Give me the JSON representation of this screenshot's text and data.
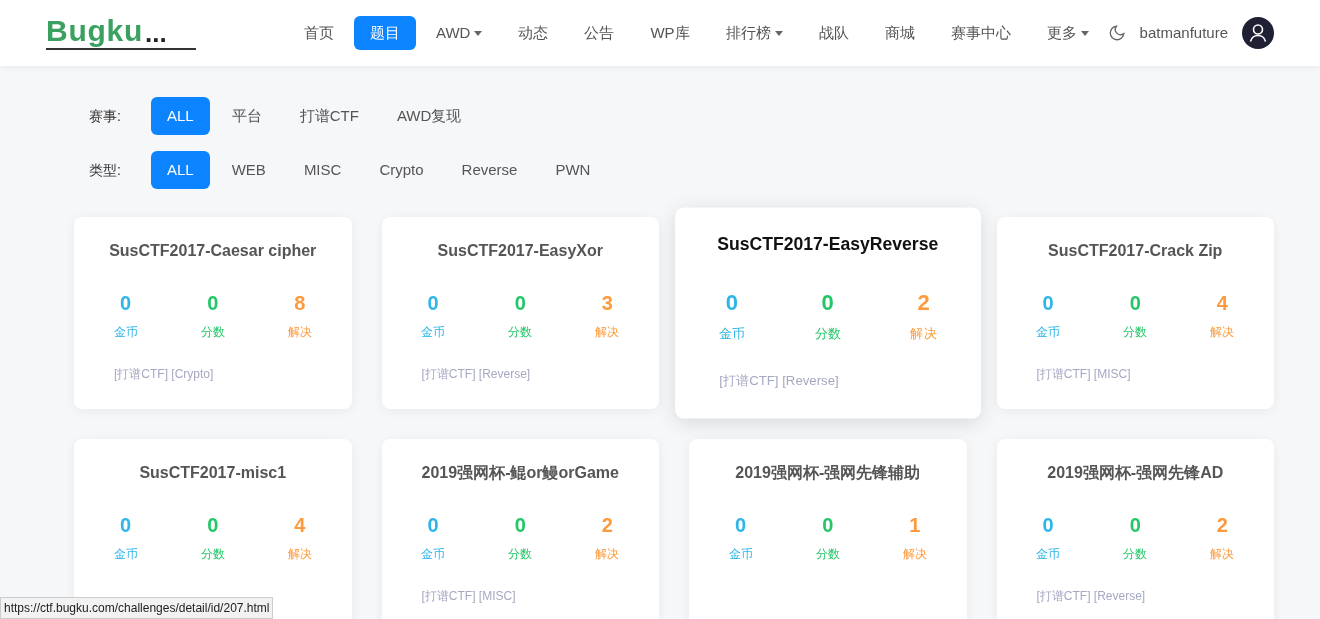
{
  "logo": {
    "text": "Bugku",
    "suffix": "..."
  },
  "nav": [
    {
      "label": "首页",
      "selected": false,
      "dropdown": false
    },
    {
      "label": "题目",
      "selected": true,
      "dropdown": false
    },
    {
      "label": "AWD",
      "selected": false,
      "dropdown": true
    },
    {
      "label": "动态",
      "selected": false,
      "dropdown": false
    },
    {
      "label": "公告",
      "selected": false,
      "dropdown": false
    },
    {
      "label": "WP库",
      "selected": false,
      "dropdown": false
    },
    {
      "label": "排行榜",
      "selected": false,
      "dropdown": true
    },
    {
      "label": "战队",
      "selected": false,
      "dropdown": false
    },
    {
      "label": "商城",
      "selected": false,
      "dropdown": false
    },
    {
      "label": "赛事中心",
      "selected": false,
      "dropdown": false
    },
    {
      "label": "更多",
      "selected": false,
      "dropdown": true
    }
  ],
  "user": {
    "name": "batmanfuture"
  },
  "filters": [
    {
      "label": "赛事:",
      "options": [
        {
          "label": "ALL",
          "selected": true
        },
        {
          "label": "平台",
          "selected": false
        },
        {
          "label": "打谱CTF",
          "selected": false
        },
        {
          "label": "AWD复现",
          "selected": false
        }
      ]
    },
    {
      "label": "类型:",
      "options": [
        {
          "label": "ALL",
          "selected": true
        },
        {
          "label": "WEB",
          "selected": false
        },
        {
          "label": "MISC",
          "selected": false
        },
        {
          "label": "Crypto",
          "selected": false
        },
        {
          "label": "Reverse",
          "selected": false
        },
        {
          "label": "PWN",
          "selected": false
        }
      ]
    }
  ],
  "challenges": [
    {
      "title": "SusCTF2017-Caesar cipher",
      "stats": [
        {
          "value": "0",
          "label": "金币"
        },
        {
          "value": "0",
          "label": "分数"
        },
        {
          "value": "8",
          "label": "解决"
        }
      ],
      "tags": "[打谱CTF] [Crypto]",
      "hovered": false
    },
    {
      "title": "SusCTF2017-EasyXor",
      "stats": [
        {
          "value": "0",
          "label": "金币"
        },
        {
          "value": "0",
          "label": "分数"
        },
        {
          "value": "3",
          "label": "解决"
        }
      ],
      "tags": "[打谱CTF] [Reverse]",
      "hovered": false
    },
    {
      "title": "SusCTF2017-EasyReverse",
      "stats": [
        {
          "value": "0",
          "label": "金币"
        },
        {
          "value": "0",
          "label": "分数"
        },
        {
          "value": "2",
          "label": "解决"
        }
      ],
      "tags": "[打谱CTF] [Reverse]",
      "hovered": true
    },
    {
      "title": "SusCTF2017-Crack Zip",
      "stats": [
        {
          "value": "0",
          "label": "金币"
        },
        {
          "value": "0",
          "label": "分数"
        },
        {
          "value": "4",
          "label": "解决"
        }
      ],
      "tags": "[打谱CTF] [MISC]",
      "hovered": false
    },
    {
      "title": "SusCTF2017-misc1",
      "stats": [
        {
          "value": "0",
          "label": "金币"
        },
        {
          "value": "0",
          "label": "分数"
        },
        {
          "value": "4",
          "label": "解决"
        }
      ],
      "hovered": false
    },
    {
      "title": "2019强网杯-鲲or鳗orGame",
      "stats": [
        {
          "value": "0",
          "label": "金币"
        },
        {
          "value": "0",
          "label": "分数"
        },
        {
          "value": "2",
          "label": "解决"
        }
      ],
      "tags": "[打谱CTF] [MISC]",
      "hovered": false
    },
    {
      "title": "2019强网杯-强网先锋辅助",
      "stats": [
        {
          "value": "0",
          "label": "金币"
        },
        {
          "value": "0",
          "label": "分数"
        },
        {
          "value": "1",
          "label": "解决"
        }
      ],
      "hovered": false
    },
    {
      "title": "2019强网杯-强网先锋AD",
      "stats": [
        {
          "value": "0",
          "label": "金币"
        },
        {
          "value": "0",
          "label": "分数"
        },
        {
          "value": "2",
          "label": "解决"
        }
      ],
      "tags": "[打谱CTF] [Reverse]",
      "hovered": false
    }
  ],
  "status_bar": {
    "url": "https://ctf.bugku.com/challenges/detail/id/207.html"
  }
}
